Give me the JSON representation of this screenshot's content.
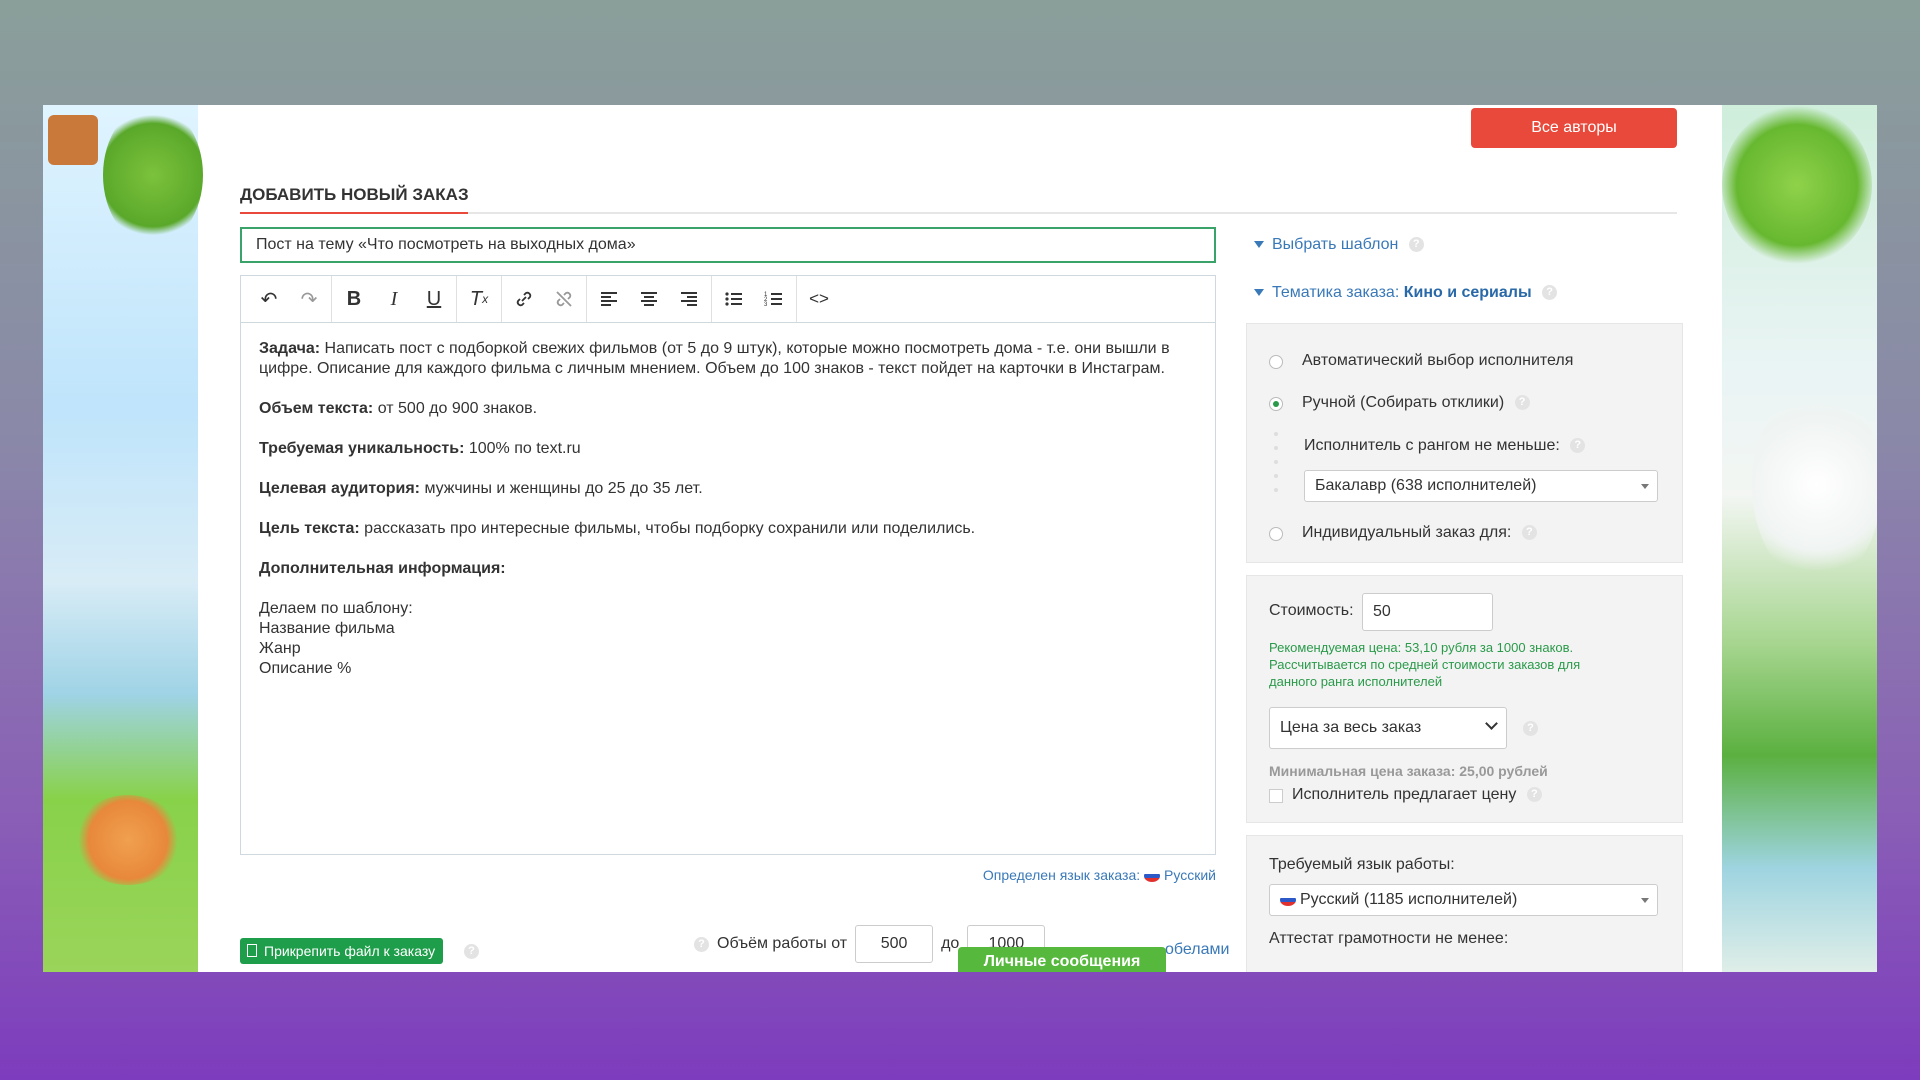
{
  "header": {
    "all_authors_button": "Все авторы"
  },
  "page_title": "ДОБАВИТЬ НОВЫЙ ЗАКАЗ",
  "subject_value": "Пост на тему «Что посмотреть на выходных дома»",
  "toolbar": {
    "icons": [
      "undo-icon",
      "redo-icon",
      "bold-icon",
      "italic-icon",
      "underline-icon",
      "clear-format-icon",
      "link-icon",
      "unlink-icon",
      "align-left-icon",
      "align-center-icon",
      "align-right-icon",
      "bulleted-list-icon",
      "numbered-list-icon",
      "source-code-icon"
    ]
  },
  "body": {
    "task_label": "Задача:",
    "task_text": " Написать пост с подборкой свежих фильмов (от 5 до 9 штук), которые можно посмотреть дома - т.е. они вышли в цифре. Описание для каждого фильма с личным мнением. Объем до 100 знаков - текст пойдет на карточки в Инстаграм.",
    "volume_label": "Объем текста:",
    "volume_text": " от 500 до 900 знаков.",
    "unique_label": "Требуемая уникальность:",
    "unique_text": " 100% по text.ru",
    "audience_label": "Целевая аудитория:",
    "audience_text": " мужчины и женщины до 25 до 35 лет.",
    "goal_label": "Цель текста:",
    "goal_text": " рассказать про интересные фильмы, чтобы подборку сохранили или поделились.",
    "extra_label": "Дополнительная информация:",
    "template_lines": [
      "Делаем по шаблону:",
      "Название фильма",
      "Жанр",
      "Описание %"
    ]
  },
  "language_detected": {
    "label": "Определен язык заказа:",
    "value": "Русский"
  },
  "attach_button": "Прикрепить файл к заказу",
  "work_volume": {
    "label": "Объём работы от",
    "from": "500",
    "to_label": "до",
    "to": "1000",
    "tail": "обелами"
  },
  "private_messages": "Личные сообщения",
  "right": {
    "choose_template": "Выбрать шаблон",
    "topic_label": "Тематика заказа:",
    "topic_value": "Кино и сериалы",
    "auto_select": "Автоматический выбор исполнителя",
    "manual_select": "Ручной (Собирать отклики)",
    "rank_label": "Исполнитель с рангом не меньше:",
    "rank_value": "Бакалавр (638 исполнителей)",
    "individual": "Индивидуальный заказ для:",
    "cost_label": "Стоимость:",
    "cost_value": "50",
    "recommend_lines": [
      "Рекомендуемая цена: 53,10 рубля за 1000 знаков.",
      "Рассчитывается по средней стоимости заказов для",
      "данного ранга исполнителей"
    ],
    "price_type": "Цена за весь заказ",
    "min_price": "Минимальная цена заказа: 25,00 рублей",
    "performer_offers": "Исполнитель предлагает цену",
    "lang_label": "Требуемый язык работы:",
    "lang_value": "Русский (1185 исполнителей)",
    "literacy_label": "Аттестат грамотности не менее:"
  },
  "colors": {
    "accent_red": "#e8493a",
    "green": "#1e9e4b",
    "link_blue": "#3a79b8"
  }
}
